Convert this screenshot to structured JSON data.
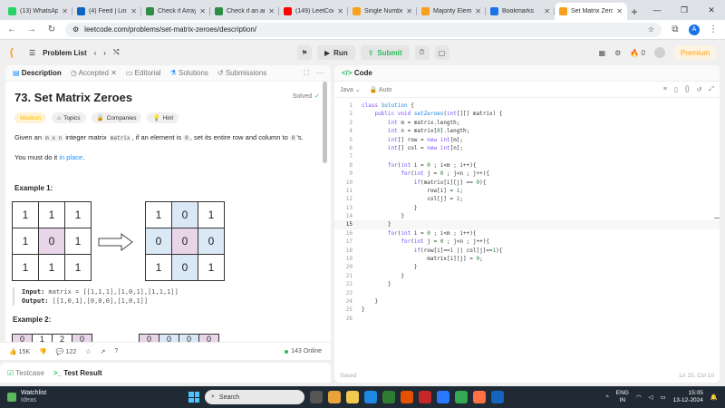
{
  "browser": {
    "tabs": [
      {
        "label": "(13) WhatsApp",
        "color": "#25d366",
        "active": false
      },
      {
        "label": "(4) Feed | LinkedIn",
        "color": "#0a66c2",
        "active": false
      },
      {
        "label": "Check if Array",
        "color": "#2f8d46",
        "active": false
      },
      {
        "label": "Check if an array",
        "color": "#2f8d46",
        "active": false
      },
      {
        "label": "(149) LeetCode",
        "color": "#ff0000",
        "active": false
      },
      {
        "label": "Single Number",
        "color": "#f89f1b",
        "active": false
      },
      {
        "label": "Majority Element",
        "color": "#f89f1b",
        "active": false
      },
      {
        "label": "Bookmarks",
        "color": "#1a73e8",
        "active": false
      },
      {
        "label": "Set Matrix Zeroes",
        "color": "#f89f1b",
        "active": true
      }
    ],
    "url": "leetcode.com/problems/set-matrix-zeroes/description/",
    "profile_initial": "A"
  },
  "nav": {
    "problem_list": "Problem List",
    "run": "Run",
    "submit": "Submit",
    "streak": "0",
    "premium": "Premium"
  },
  "desc_tabs": {
    "description": "Description",
    "accepted": "Accepted",
    "editorial": "Editorial",
    "solutions": "Solutions",
    "submissions": "Submissions"
  },
  "problem": {
    "title": "73. Set Matrix Zeroes",
    "solved": "Solved",
    "difficulty": "Medium",
    "topics": "Topics",
    "companies": "Companies",
    "hint": "Hint",
    "para1_a": "Given an ",
    "para1_code1": "m x n",
    "para1_b": " integer matrix ",
    "para1_code2": "matrix",
    "para1_c": ", if an element is ",
    "para1_code3": "0",
    "para1_d": ", set its entire row and column to ",
    "para1_code4": "0",
    "para1_e": "'s.",
    "para2_a": "You must do it ",
    "para2_link": "in place",
    "para2_b": ".",
    "example1_title": "Example 1:",
    "example1_input_label": "Input:",
    "example1_input": " matrix = [[1,1,1],[1,0,1],[1,1,1]]",
    "example1_output_label": "Output:",
    "example1_output": " [[1,0,1],[0,0,0],[1,0,1]]",
    "example2_title": "Example 2:",
    "input_matrix": [
      "1",
      "1",
      "1",
      "1",
      "0",
      "1",
      "1",
      "1",
      "1"
    ],
    "output_matrix": [
      "1",
      "0",
      "1",
      "0",
      "0",
      "0",
      "1",
      "0",
      "1"
    ],
    "example2_left_top": [
      "0",
      "1",
      "2",
      "0"
    ],
    "example2_right_top": [
      "0",
      "0",
      "0",
      "0"
    ]
  },
  "footer": {
    "likes": "15K",
    "comments": "122",
    "online": "143 Online"
  },
  "test": {
    "testcase": "Testcase",
    "result": "Test Result"
  },
  "editor": {
    "title": "Code",
    "language": "Java",
    "mode": "Auto",
    "saved": "Saved",
    "cursor": "Ln 15, Col 10",
    "lines": [
      "class Solution {",
      "    public void setZeroes(int[][] matrix) {",
      "        int m = matrix.length;",
      "        int n = matrix[0].length;",
      "        int[] row = new int[m];",
      "        int[] col = new int[n];",
      "",
      "        for(int i = 0 ; i<m ; i++){",
      "            for(int j = 0 ; j<n ; j++){",
      "                if(matrix[i][j] == 0){",
      "                    row[i] = 1;",
      "                    col[j] = 1;",
      "                }",
      "            }",
      "        }",
      "        for(int i = 0 ; i<m ; i++){",
      "            for(int j = 0 ; j<n ; j++){",
      "                if(row[i]==1 || col[j]==1){",
      "                    matrix[i][j] = 0;",
      "                }",
      "            }",
      "        }",
      "",
      "    }",
      "}",
      ""
    ]
  },
  "taskbar": {
    "weather_title": "Watchlist",
    "weather_sub": "Ideas",
    "search": "Search",
    "lang1": "ENG",
    "lang2": "IN",
    "time": "15:05",
    "date": "13-12-2024"
  }
}
